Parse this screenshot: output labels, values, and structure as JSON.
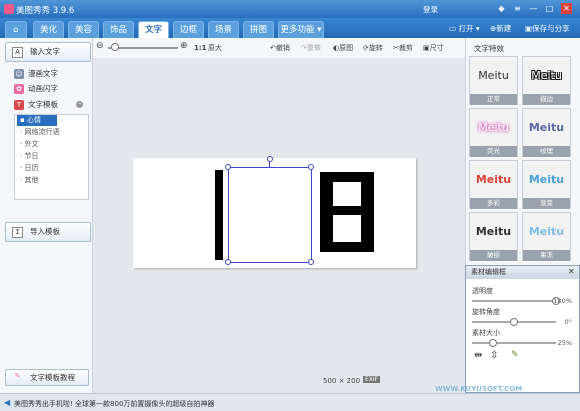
{
  "window": {
    "title": "美图秀秀 3.9.6",
    "login": "登录"
  },
  "tabs": [
    {
      "label": "美化"
    },
    {
      "label": "美容"
    },
    {
      "label": "饰品"
    },
    {
      "label": "文字"
    },
    {
      "label": "边框"
    },
    {
      "label": "场景"
    },
    {
      "label": "拼图"
    },
    {
      "label": "更多功能"
    }
  ],
  "top_actions": {
    "open": "打开",
    "new": "新建",
    "save": "保存与分享"
  },
  "toolbar": {
    "ratio": "1:1",
    "original": "原大",
    "undo": "撤销",
    "redo": "重做",
    "compare": "原图",
    "rotate": "旋转",
    "crop": "裁剪",
    "size": "尺寸",
    "zoom_level": 0.1
  },
  "left": {
    "input_text": "输入文字",
    "comic_text": "漫画文字",
    "anim_text": "动画闪字",
    "template_header": "文字模板",
    "categories": [
      "心情",
      "网络流行语",
      "外文",
      "节日",
      "日历",
      "其他"
    ],
    "import_template": "导入模板",
    "tutorial": "文字模板教程"
  },
  "canvas": {
    "size": "500 × 200",
    "exif": "EXIF"
  },
  "right": {
    "header": "文字特效",
    "effects": [
      {
        "sample": "Meitu",
        "label": "正常"
      },
      {
        "sample": "Meitu",
        "label": "描边"
      },
      {
        "sample": "Meitu",
        "label": "荧光"
      },
      {
        "sample": "Meitu",
        "label": "纹理"
      },
      {
        "sample": "Meitu",
        "label": "多彩"
      },
      {
        "sample": "Meitu",
        "label": "渐变"
      },
      {
        "sample": "Meitu",
        "label": "破损"
      },
      {
        "sample": "Meitu",
        "label": "果冻"
      }
    ]
  },
  "material_panel": {
    "title": "素材编辑框",
    "opacity_label": "透明度",
    "opacity_value": "100%",
    "opacity": 1.0,
    "rotate_label": "旋转角度",
    "rotate_value": "0°",
    "rotate": 0.5,
    "size_label": "素材大小",
    "size_value": "25%",
    "size": 0.25
  },
  "status": {
    "message": "美图秀秀出手机啦! 全球第一款800万前置摄像头的超级自拍神器"
  },
  "watermark": "WWW.KUYUSOFT.COM",
  "colors": {
    "titlebar": "#2a6fbf",
    "accent": "#3948c7"
  }
}
